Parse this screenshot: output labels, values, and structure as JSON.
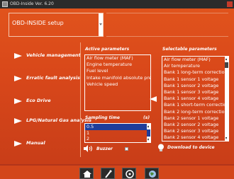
{
  "window": {
    "title": "OBD-Inside Ver. 6.20"
  },
  "header": {
    "title": "OBD-INSIDE setup"
  },
  "menu": {
    "items": [
      {
        "label": "Vehicle management"
      },
      {
        "label": "Erratic fault analysis"
      },
      {
        "label": "Eco Drive"
      },
      {
        "label": "LPG/Natural Gas analysis"
      },
      {
        "label": "Manual"
      }
    ]
  },
  "active": {
    "heading": "Active parameters",
    "items": [
      "Air flow meter (MAF)",
      "Engine temperature",
      "Fuel level",
      "Intake manifold absolute pres",
      "Vehicle speed"
    ]
  },
  "selectable": {
    "heading": "Selectable parameters",
    "items": [
      "Air flow meter (MAF)",
      "Air temperature",
      "Bank 1 long-term correction",
      "Bank 1 sensor 1 voltage",
      "Bank 1 sensor 2 voltage",
      "Bank 1 sensor 3 voltage",
      "Bank 1 sensor 4 voltage",
      "Bank 1 short-term correction",
      "Bank 2 long-term correction",
      "Bank 2 sensor 1 voltage",
      "Bank 2 sensor 2 voltage",
      "Bank 2 sensor 3 voltage",
      "Bank 2 sensor 4 voltage"
    ]
  },
  "sampling": {
    "label": "Sampling time",
    "unit": "(s)",
    "options": [
      "0.5",
      "1",
      "2"
    ],
    "selected": "0.5"
  },
  "buzzer": {
    "label": "Buzzer",
    "checked": false
  },
  "download": {
    "label": "Download to device"
  },
  "toolbar": {
    "icons": [
      "home-icon",
      "tools-icon",
      "wheel-icon",
      "globe-icon"
    ]
  },
  "colors": {
    "background": "#d9481a",
    "selection": "#1f3d9a",
    "text": "#ffffff"
  }
}
